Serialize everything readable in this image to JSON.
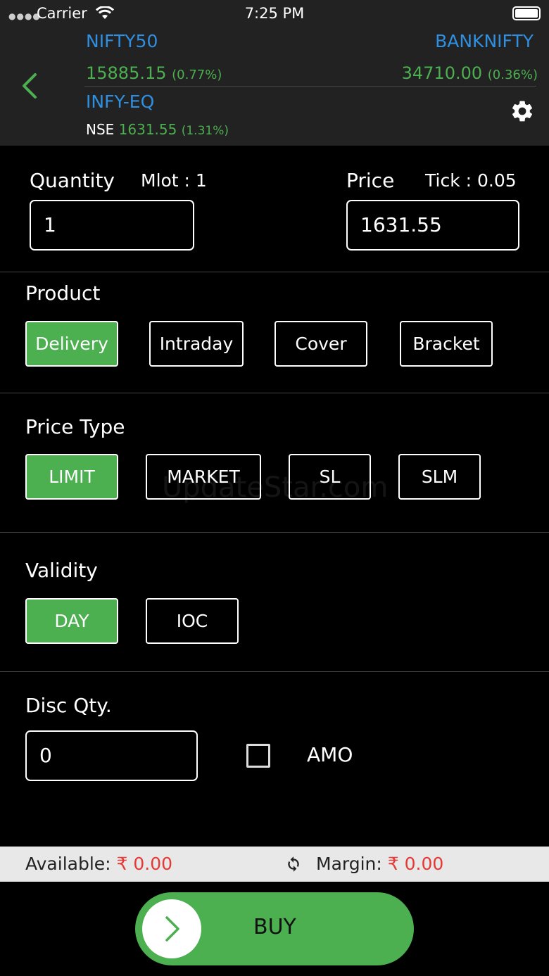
{
  "status_bar": {
    "carrier": "Carrier",
    "time": "7:25 PM"
  },
  "header": {
    "index1": {
      "name": "NIFTY50",
      "value": "15885.15",
      "change": "(0.77%)"
    },
    "index2": {
      "name": "BANKNIFTY",
      "value": "34710.00",
      "change": "(0.36%)"
    },
    "symbol": {
      "name": "INFY-EQ",
      "exchange": "NSE",
      "price": "1631.55",
      "change": "(1.31%)"
    }
  },
  "quantity": {
    "label": "Quantity",
    "mlot": "Mlot : 1",
    "value": "1"
  },
  "price": {
    "label": "Price",
    "tick": "Tick : 0.05",
    "value": "1631.55"
  },
  "product": {
    "label": "Product",
    "options": [
      "Delivery",
      "Intraday",
      "Cover",
      "Bracket"
    ],
    "selected": "Delivery"
  },
  "price_type": {
    "label": "Price Type",
    "options": [
      "LIMIT",
      "MARKET",
      "SL",
      "SLM"
    ],
    "selected": "LIMIT"
  },
  "validity": {
    "label": "Validity",
    "options": [
      "DAY",
      "IOC"
    ],
    "selected": "DAY"
  },
  "disc_qty": {
    "label": "Disc Qty.",
    "value": "0"
  },
  "amo": {
    "label": "AMO",
    "checked": false
  },
  "footer": {
    "available_label": "Available:",
    "available_value": "₹ 0.00",
    "margin_label": "Margin:",
    "margin_value": "₹ 0.00"
  },
  "buy_button": {
    "label": "BUY"
  },
  "watermark": "UpdateStar.com",
  "colors": {
    "accent": "#4caf50",
    "link": "#2f8fe0",
    "negative": "#e53935"
  }
}
